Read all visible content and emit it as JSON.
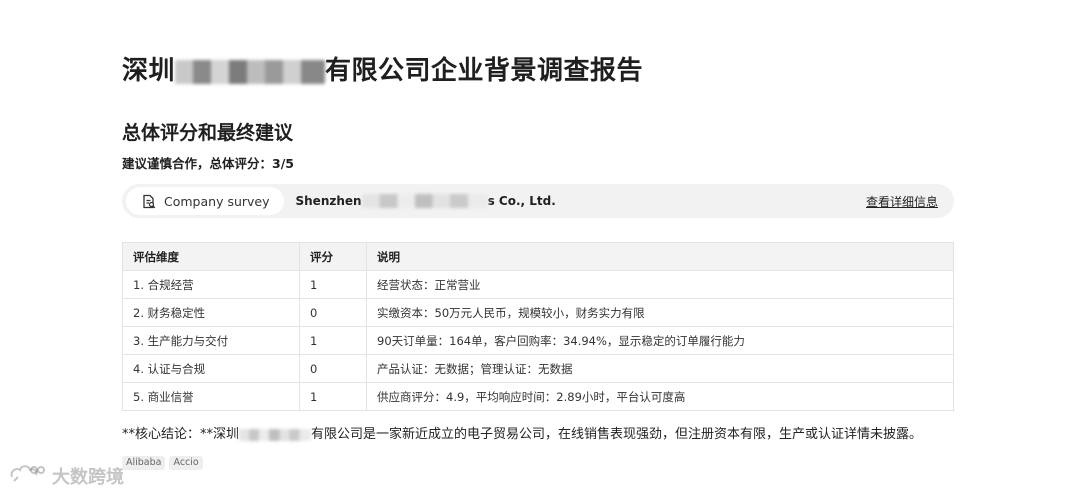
{
  "report": {
    "title_prefix": "深圳",
    "title_suffix": "有限公司企业背景调查报告"
  },
  "section": {
    "heading": "总体评分和最终建议",
    "verdict": "建议谨慎合作，总体评分：3/5"
  },
  "company_bar": {
    "chip_label": "Company survey",
    "name_prefix": "Shenzhen",
    "name_suffix": "s Co., Ltd.",
    "detail_link": "查看详细信息"
  },
  "table": {
    "headers": [
      "评估维度",
      "评分",
      "说明"
    ],
    "rows": [
      {
        "dimension": "1. 合规经营",
        "score": "1",
        "note": "经营状态：正常营业"
      },
      {
        "dimension": "2. 财务稳定性",
        "score": "0",
        "note": "实缴资本：50万元人民币，规模较小，财务实力有限"
      },
      {
        "dimension": "3. 生产能力与交付",
        "score": "1",
        "note": "90天订单量：164单，客户回购率：34.94%，显示稳定的订单履行能力"
      },
      {
        "dimension": "4. 认证与合规",
        "score": "0",
        "note": "产品认证：无数据；管理认证：无数据"
      },
      {
        "dimension": "5. 商业信誉",
        "score": "1",
        "note": "供应商评分：4.9，平均响应时间：2.89小时，平台认可度高"
      }
    ]
  },
  "conclusion": {
    "prefix": "**核心结论：**深圳",
    "suffix": "有限公司是一家新近成立的电子贸易公司，在线销售表现强劲，但注册资本有限，生产或认证详情未披露。"
  },
  "tags": [
    "Alibaba",
    "Accio"
  ],
  "watermark": {
    "text": "大数跨境",
    "icon": "cloud-logo-icon"
  }
}
